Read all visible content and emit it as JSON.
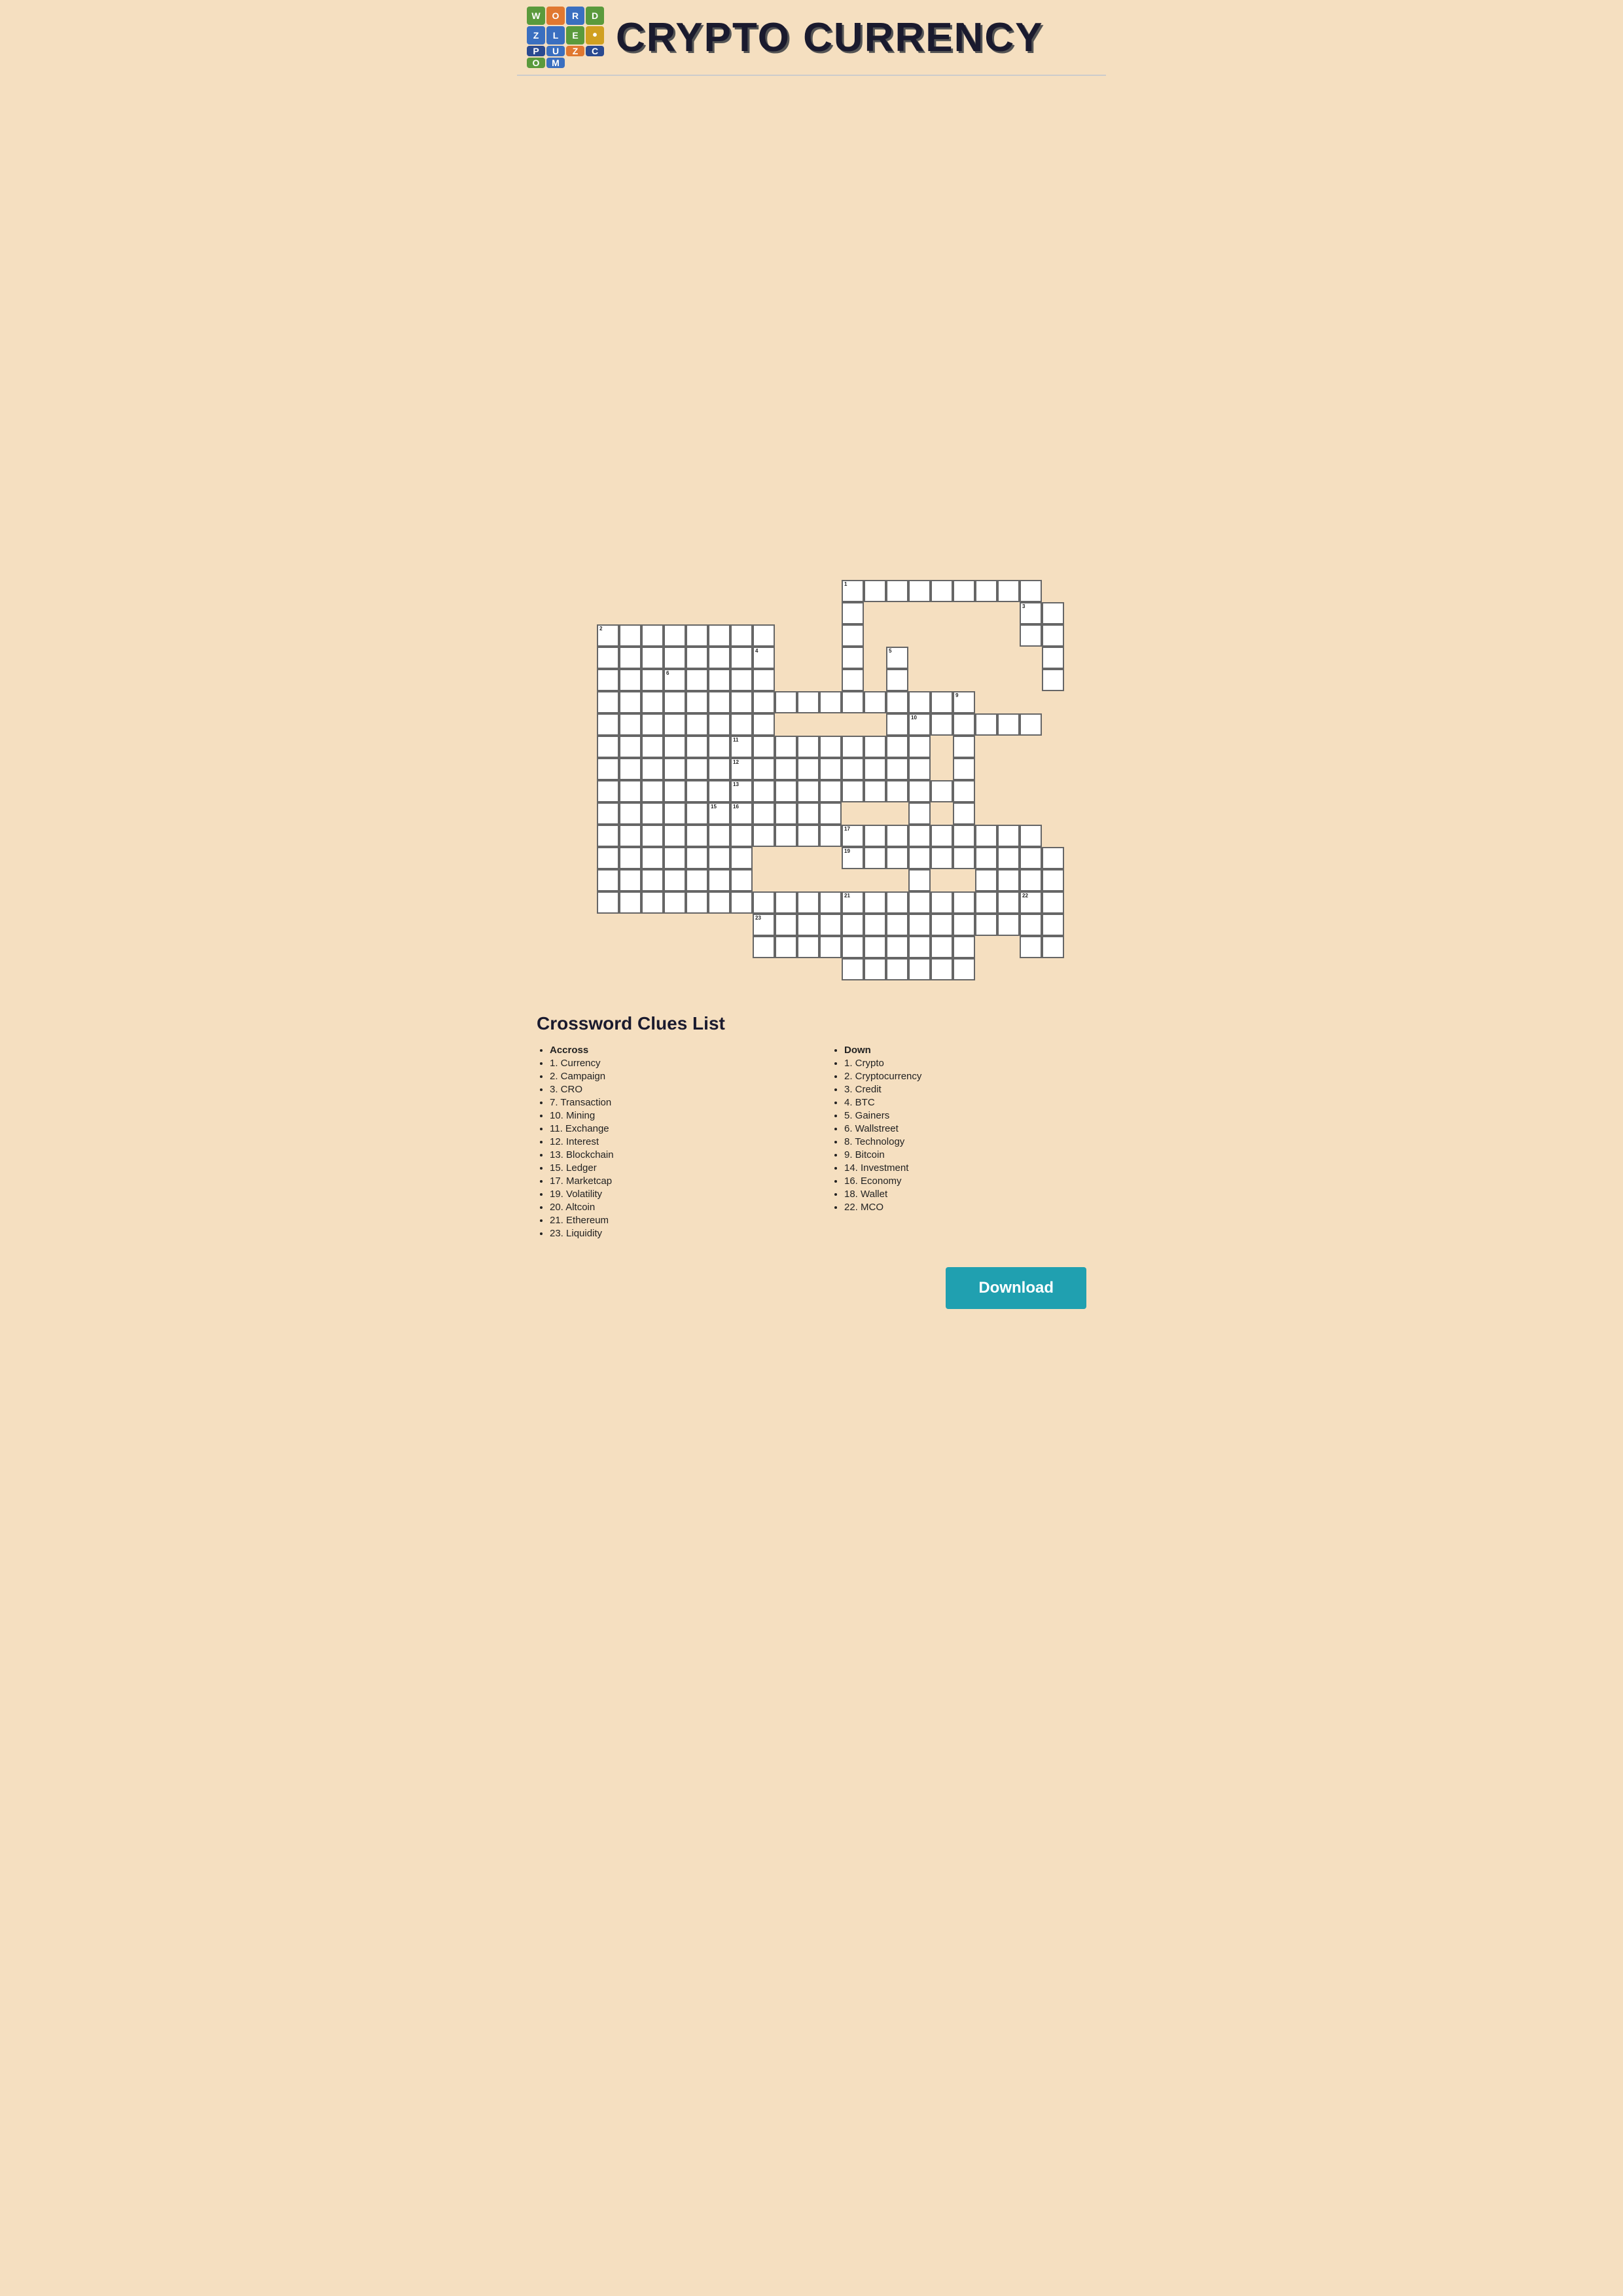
{
  "header": {
    "title": "CRYPTO CURRENCY",
    "logo_letters": [
      {
        "letter": "W",
        "color": "green"
      },
      {
        "letter": "O",
        "color": "orange"
      },
      {
        "letter": "R",
        "color": "blue"
      },
      {
        "letter": "D",
        "color": "green"
      },
      {
        "letter": "Z",
        "color": "blue"
      },
      {
        "letter": "L",
        "color": "blue"
      },
      {
        "letter": "E",
        "color": "green"
      },
      {
        "letter": "•",
        "color": "yellow"
      },
      {
        "letter": "P",
        "color": "orange"
      },
      {
        "letter": "U",
        "color": "blue"
      },
      {
        "letter": "Z",
        "color": "orange"
      },
      {
        "letter": "C",
        "color": "dark-blue"
      },
      {
        "letter": "O",
        "color": "green"
      },
      {
        "letter": "M",
        "color": "blue"
      }
    ]
  },
  "clues": {
    "title": "Crossword Clues List",
    "across_label": "Accross",
    "across_items": [
      "1. Currency",
      "2. Campaign",
      "3. CRO",
      "7. Transaction",
      "10. Mining",
      "11. Exchange",
      "12. Interest",
      "13. Blockchain",
      "15. Ledger",
      "17. Marketcap",
      "19. Volatility",
      "20. Altcoin",
      "21. Ethereum",
      "23. Liquidity"
    ],
    "down_label": "Down",
    "down_items": [
      "1. Crypto",
      "2. Cryptocurrency",
      "3. Credit",
      "4. BTC",
      "5. Gainers",
      "6. Wallstreet",
      "8. Technology",
      "9. Bitcoin",
      "14. Investment",
      "16. Economy",
      "18. Wallet",
      "22. MCO"
    ]
  },
  "download_button": "Download"
}
